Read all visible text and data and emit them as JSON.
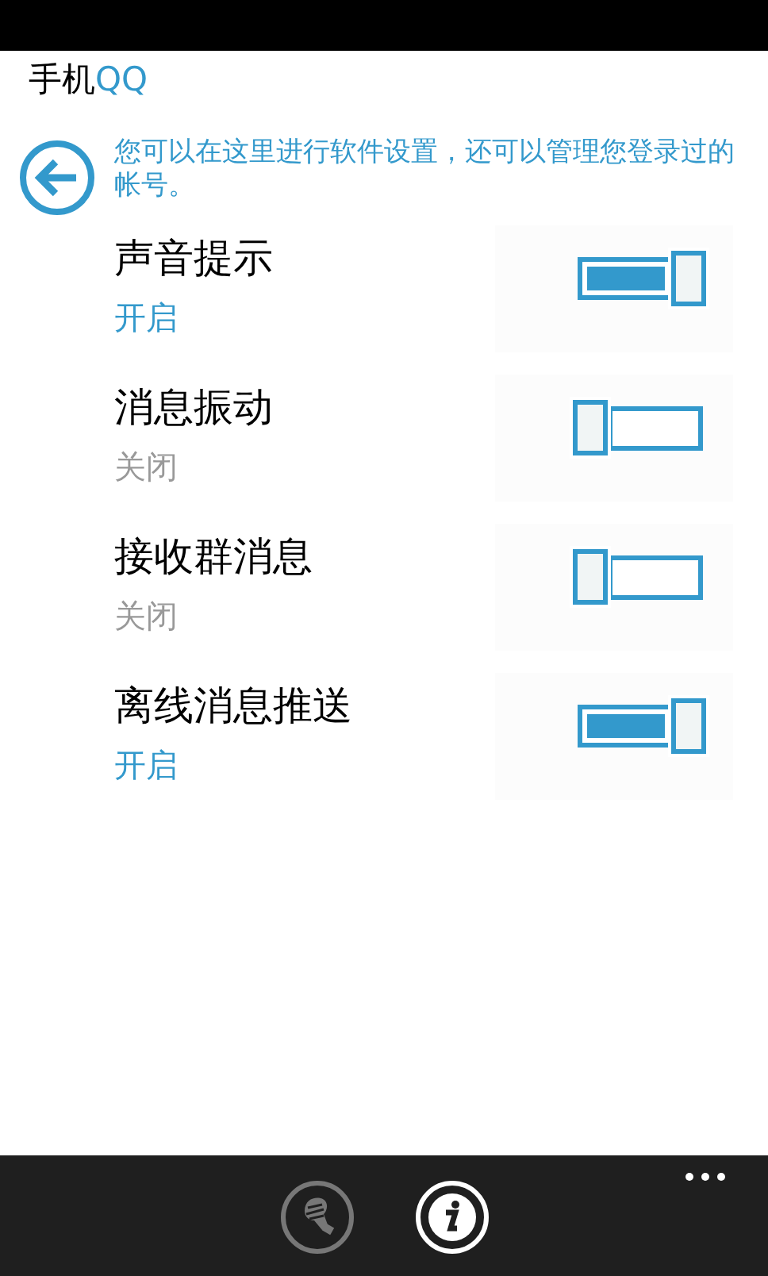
{
  "app_title": {
    "prefix": "手机",
    "brand": "QQ"
  },
  "description": "您可以在这里进行软件设置，还可以管理您登录过的帐号。",
  "settings": [
    {
      "label": "声音提示",
      "state_text": "开启",
      "on": true
    },
    {
      "label": "消息振动",
      "state_text": "关闭",
      "on": false
    },
    {
      "label": "接收群消息",
      "state_text": "关闭",
      "on": false
    },
    {
      "label": "离线消息推送",
      "state_text": "开启",
      "on": true
    }
  ],
  "app_bar": {
    "buttons": [
      {
        "kind": "brush",
        "disabled": true
      },
      {
        "kind": "info",
        "disabled": false
      }
    ]
  }
}
